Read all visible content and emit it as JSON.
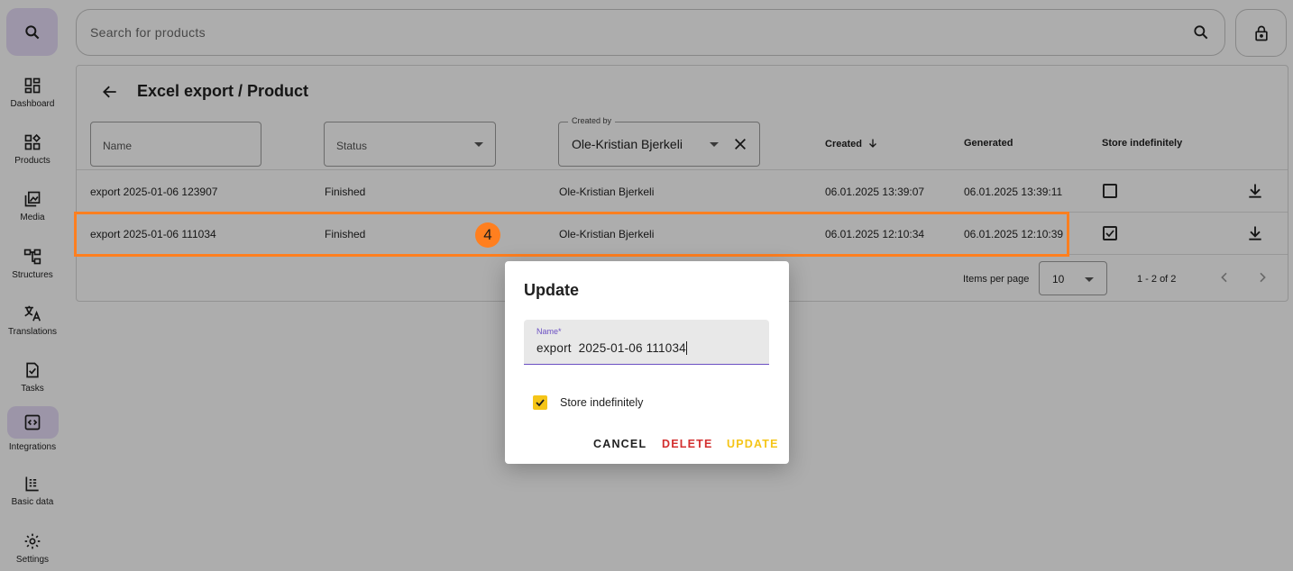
{
  "sidebar": {
    "items": [
      {
        "label": "Dashboard",
        "icon": "dashboard-icon"
      },
      {
        "label": "Products",
        "icon": "products-icon"
      },
      {
        "label": "Media",
        "icon": "media-icon"
      },
      {
        "label": "Structures",
        "icon": "structures-icon"
      },
      {
        "label": "Translations",
        "icon": "translate-icon"
      },
      {
        "label": "Tasks",
        "icon": "tasks-icon"
      },
      {
        "label": "Integrations",
        "icon": "integrations-icon"
      },
      {
        "label": "Basic data",
        "icon": "basic-data-icon"
      },
      {
        "label": "Settings",
        "icon": "gear-icon"
      }
    ]
  },
  "search": {
    "placeholder": "Search for products"
  },
  "page": {
    "title": "Excel export / Product"
  },
  "filters": {
    "name_label": "Name",
    "status_label": "Status",
    "created_by_label": "Created by",
    "created_by_value": "Ole-Kristian Bjerkeli"
  },
  "columns": {
    "created": "Created",
    "generated": "Generated",
    "store": "Store indefinitely"
  },
  "rows": [
    {
      "name": "export 2025-01-06 123907",
      "status": "Finished",
      "created_by": "Ole-Kristian Bjerkeli",
      "created": "06.01.2025 13:39:07",
      "generated": "06.01.2025 13:39:11",
      "store": false
    },
    {
      "name": "export 2025-01-06 111034",
      "status": "Finished",
      "created_by": "Ole-Kristian Bjerkeli",
      "created": "06.01.2025 12:10:34",
      "generated": "06.01.2025 12:10:39",
      "store": true
    }
  ],
  "pagination": {
    "items_per_page_label": "Items per page",
    "items_per_page": "10",
    "range": "1 - 2 of 2"
  },
  "annotation": {
    "badge": "4",
    "color": "#ff7f1f"
  },
  "dialog": {
    "title": "Update",
    "name_label": "Name*",
    "name_value": "export  2025-01-06 111034",
    "store_label": "Store indefinitely",
    "store_checked": true,
    "cancel": "CANCEL",
    "delete": "DELETE",
    "update": "UPDATE"
  },
  "colors": {
    "accent": "#e6dcf8",
    "primary": "#6b4fc3",
    "delete": "#d32f2f",
    "update": "#f5c518",
    "annotation": "#ff7f1f"
  }
}
